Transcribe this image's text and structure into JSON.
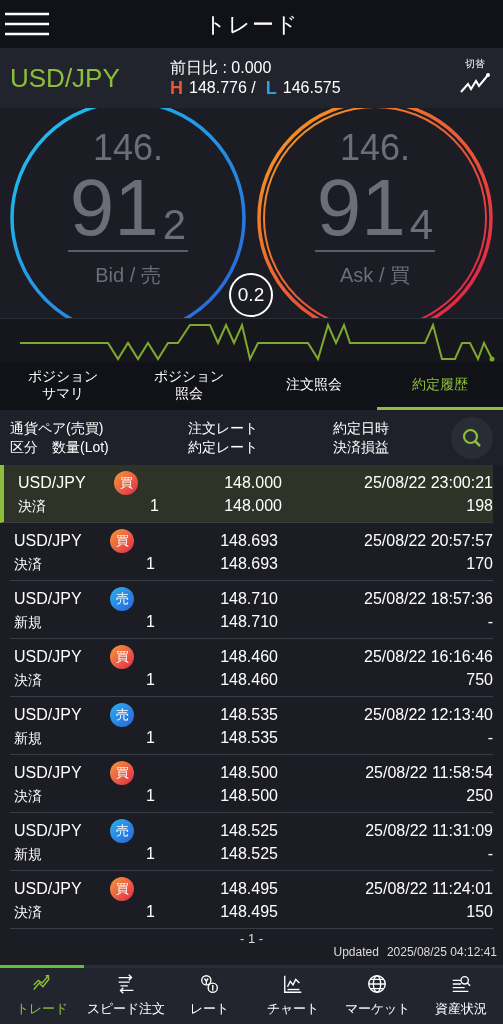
{
  "header": {
    "title": "トレード"
  },
  "quote": {
    "pair": "USD/JPY",
    "change": "前日比 : 0.000",
    "high_label": "H",
    "high": "148.776 /",
    "low_label": "L",
    "low": "146.575",
    "switch_label": "切替"
  },
  "prices": [
    {
      "kind": "bid",
      "big_prefix": "146.",
      "main": "91",
      "pip": "2",
      "label": "Bid / 売"
    },
    {
      "kind": "ask",
      "big_prefix": "146.",
      "main": "91",
      "pip": "4",
      "label": "Ask / 買"
    }
  ],
  "spread": "0.2",
  "tabs": [
    {
      "lines": [
        "ポジション",
        "サマリ"
      ],
      "selected": false
    },
    {
      "lines": [
        "ポジション",
        "照会"
      ],
      "selected": false
    },
    {
      "lines": [
        "注文照会"
      ],
      "selected": false
    },
    {
      "lines": [
        "約定履歴"
      ],
      "selected": true
    }
  ],
  "table": {
    "columns": [
      {
        "line1": "通貨ペア(売買)",
        "line2": "区分　数量(Lot)"
      },
      {
        "line1": "注文レート",
        "line2": "約定レート"
      },
      {
        "line1": "約定日時",
        "line2": "決済損益"
      }
    ],
    "rows": [
      {
        "pair": "USD/JPY",
        "kind": "buy",
        "side_label": "買",
        "type": "決済",
        "lot": "1",
        "order_rate": "148.000",
        "exec_rate": "148.000",
        "time": "25/08/22 23:00:21",
        "pl": "198",
        "selected": true
      },
      {
        "pair": "USD/JPY",
        "kind": "buy",
        "side_label": "買",
        "type": "決済",
        "lot": "1",
        "order_rate": "148.693",
        "exec_rate": "148.693",
        "time": "25/08/22 20:57:57",
        "pl": "170",
        "selected": false
      },
      {
        "pair": "USD/JPY",
        "kind": "sell",
        "side_label": "売",
        "type": "新規",
        "lot": "1",
        "order_rate": "148.710",
        "exec_rate": "148.710",
        "time": "25/08/22 18:57:36",
        "pl": "-",
        "selected": false
      },
      {
        "pair": "USD/JPY",
        "kind": "buy",
        "side_label": "買",
        "type": "決済",
        "lot": "1",
        "order_rate": "148.460",
        "exec_rate": "148.460",
        "time": "25/08/22 16:16:46",
        "pl": "750",
        "selected": false
      },
      {
        "pair": "USD/JPY",
        "kind": "sell",
        "side_label": "売",
        "type": "新規",
        "lot": "1",
        "order_rate": "148.535",
        "exec_rate": "148.535",
        "time": "25/08/22 12:13:40",
        "pl": "-",
        "selected": false
      },
      {
        "pair": "USD/JPY",
        "kind": "buy",
        "side_label": "買",
        "type": "決済",
        "lot": "1",
        "order_rate": "148.500",
        "exec_rate": "148.500",
        "time": "25/08/22 11:58:54",
        "pl": "250",
        "selected": false
      },
      {
        "pair": "USD/JPY",
        "kind": "sell",
        "side_label": "売",
        "type": "新規",
        "lot": "1",
        "order_rate": "148.525",
        "exec_rate": "148.525",
        "time": "25/08/22 11:31:09",
        "pl": "-",
        "selected": false
      },
      {
        "pair": "USD/JPY",
        "kind": "buy",
        "side_label": "買",
        "type": "決済",
        "lot": "1",
        "order_rate": "148.495",
        "exec_rate": "148.495",
        "time": "25/08/22 11:24:01",
        "pl": "150",
        "selected": false
      }
    ]
  },
  "page": "- 1 -",
  "updated": {
    "label": "Updated",
    "time": "2025/08/25 04:12:41"
  },
  "nav": [
    {
      "kind": "trade",
      "label": "トレード",
      "selected": true
    },
    {
      "kind": "speed",
      "label": "スピード注文",
      "selected": false
    },
    {
      "kind": "rate",
      "label": "レート",
      "selected": false
    },
    {
      "kind": "chart",
      "label": "チャート",
      "selected": false
    },
    {
      "kind": "market",
      "label": "マーケット",
      "selected": false
    },
    {
      "kind": "assets",
      "label": "資産状況",
      "selected": false
    }
  ]
}
